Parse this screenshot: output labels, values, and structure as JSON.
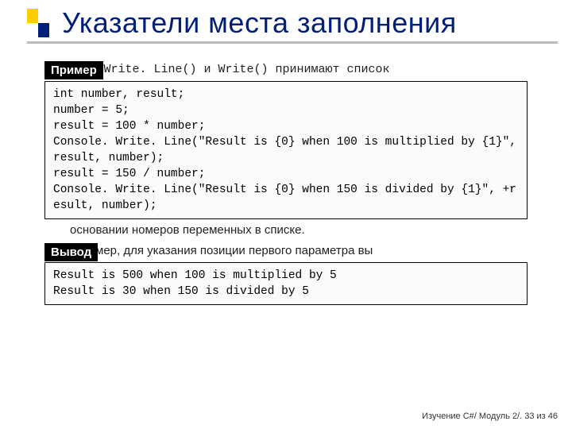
{
  "title": "Указатели места заполнения",
  "labels": {
    "example": "Пример",
    "output": "Вывод"
  },
  "behind": {
    "line1_suffix": "ы Write. Line() и Write() принимают список",
    "mid": "основании номеров переменных в списке.",
    "vyvod_behind": "Например, для указания позиции первого параметра вы"
  },
  "code": {
    "l1": "int number, result;",
    "l2": "number = 5;",
    "l3": "result = 100 * number;",
    "l4": "Console. Write. Line(\"Result is {0} when 100 is multiplied by {1}\", result, number);",
    "l5": "result = 150 / number;",
    "l6": "Console. Write. Line(\"Result is {0} when 150 is divided by {1}\", +result, number);"
  },
  "output": {
    "l1": "Result is 500 when 100 is multiplied by 5",
    "l2": "Result is 30 when 150 is divided by 5"
  },
  "footer": "Изучение C#/ Модуль 2/. 33 из 46"
}
